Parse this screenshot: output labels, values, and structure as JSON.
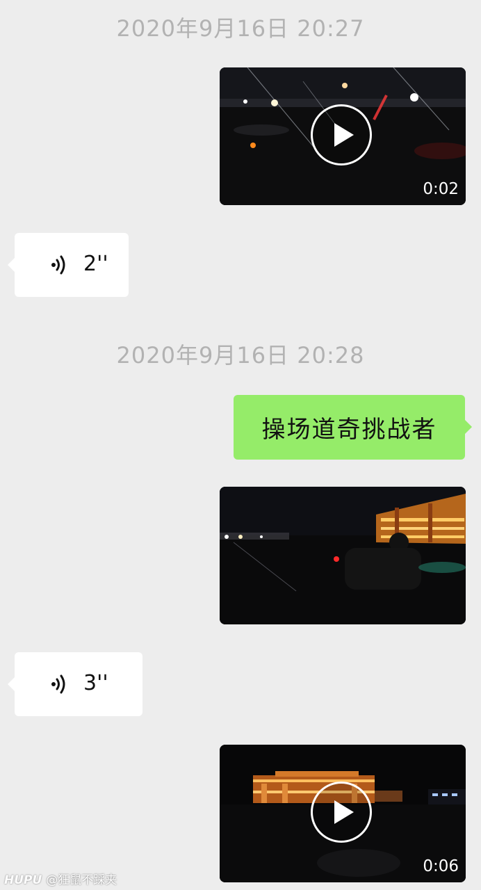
{
  "colors": {
    "background": "#ededed",
    "timestamp": "#b2b2b2",
    "sent_bubble": "#95ec69",
    "received_bubble": "#ffffff"
  },
  "messages": [
    {
      "type": "timestamp",
      "text": "2020年9月16日 20:27"
    },
    {
      "type": "video",
      "direction": "sent",
      "duration": "0:02",
      "icon": "play-icon"
    },
    {
      "type": "voice",
      "direction": "received",
      "length": "2''",
      "icon": "voice-icon"
    },
    {
      "type": "timestamp",
      "text": "2020年9月16日 20:28"
    },
    {
      "type": "text",
      "direction": "sent",
      "text": "操场道奇挑战者"
    },
    {
      "type": "video",
      "direction": "sent",
      "duration": "",
      "icon": ""
    },
    {
      "type": "voice",
      "direction": "received",
      "length": "3''",
      "icon": "voice-icon"
    },
    {
      "type": "video",
      "direction": "sent",
      "duration": "0:06",
      "icon": "play-icon"
    }
  ],
  "watermark": {
    "brand": "HUPU",
    "user": "@狂鼠不踩夹"
  }
}
